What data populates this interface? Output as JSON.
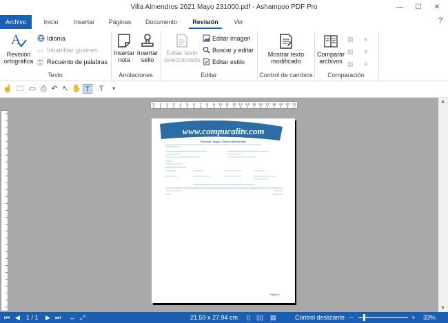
{
  "window": {
    "title": "Villa Almendros 2021 Mayo 231000.pdf - Ashampoo PDF Pro",
    "minimize": "—",
    "maximize": "☐",
    "close": "✕"
  },
  "tabs": [
    {
      "label": "Archivo"
    },
    {
      "label": "Inicio"
    },
    {
      "label": "Insertar"
    },
    {
      "label": "Páginas"
    },
    {
      "label": "Documento"
    },
    {
      "label": "Revisión"
    },
    {
      "label": "Ver"
    }
  ],
  "help_label": "?",
  "ribbon": {
    "texto": {
      "label": "Texto",
      "revision": "Revisión ortográfica",
      "idioma": "Idioma",
      "inhabilitar": "Inhabilitar guiones",
      "recuento": "Recuento de palabras"
    },
    "anotaciones": {
      "label": "Anotaciones",
      "nota": "Insertar nota",
      "sello": "Insertar sello"
    },
    "editar": {
      "label": "Editar",
      "texto_sel": "Editar texto seleccionado",
      "imagen": "Editar imagen",
      "buscar": "Buscar y editar",
      "estilo": "Editar estilo"
    },
    "control": {
      "label": "Control de cambios",
      "mostrar": "Mostrar texto modificado"
    },
    "comparacion": {
      "label": "Comparación",
      "comparar": "Comparar archivos"
    }
  },
  "page_doc": {
    "watermark": "www.compucalitv.com",
    "tagline": "Películas, Juegos, Series y Mucho Más!",
    "footer": "Página 1"
  },
  "status": {
    "page": "1 / 1",
    "size": "21.59 x 27.94 cm",
    "mode": "Control deslizante",
    "zoom": "33%",
    "zoom_minus": "−",
    "zoom_plus": "+"
  },
  "colors": {
    "accent": "#1a5fb4"
  }
}
